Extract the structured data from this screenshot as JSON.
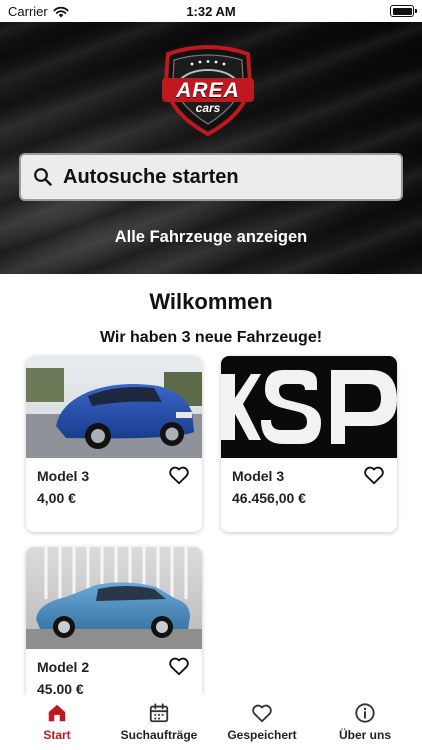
{
  "status_bar": {
    "carrier": "Carrier",
    "time": "1:32 AM"
  },
  "logo": {
    "line1": "AREA",
    "line2": "cars"
  },
  "search": {
    "label": "Autosuche starten",
    "icon": "search-icon"
  },
  "hero": {
    "all_cars_link": "Alle Fahrzeuge anzeigen"
  },
  "welcome": {
    "title": "Wilkommen",
    "subtitle": "Wir haben 3 neue Fahrzeuge!"
  },
  "listings": [
    {
      "title": "Model 3",
      "price": "4,00 €",
      "image": "blue-hatchback-photo"
    },
    {
      "title": "Model 3",
      "price": "46.456,00 €",
      "image": "ksp-letters-photo"
    },
    {
      "title": "Model 2",
      "price": "45,00 €",
      "image": "blue-suv-photo"
    }
  ],
  "nav": {
    "items": [
      {
        "label": "Start",
        "icon": "home-icon",
        "active": true
      },
      {
        "label": "Suchaufträge",
        "icon": "calendar-icon"
      },
      {
        "label": "Gespeichert",
        "icon": "heart-icon"
      },
      {
        "label": "Über uns",
        "icon": "info-icon"
      }
    ]
  },
  "colors": {
    "accent": "#c0181f",
    "hero_dark": "#0d0d0d",
    "card_bg": "#ffffff"
  }
}
